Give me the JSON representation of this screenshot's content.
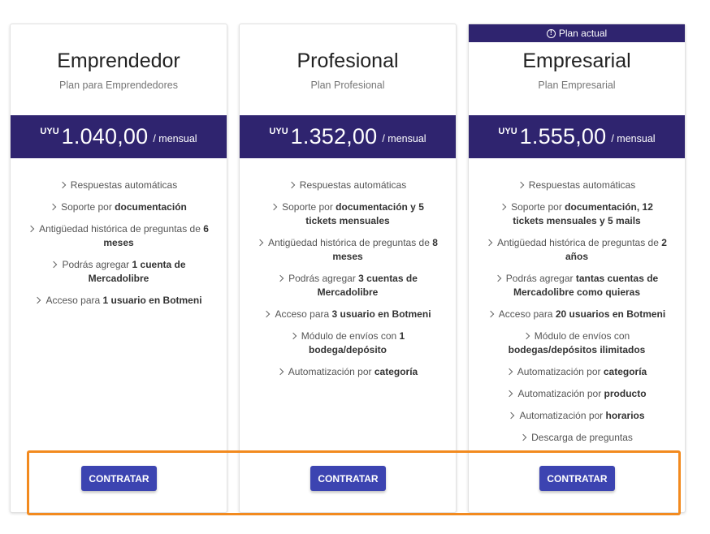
{
  "plans": [
    {
      "badge": "",
      "name": "Emprendedor",
      "subtitle": "Plan para Emprendedores",
      "currency": "UYU",
      "amount": "1.040,00",
      "period": "/ mensual",
      "features": [
        [
          [
            "Respuestas automáticas",
            false
          ]
        ],
        [
          [
            "Soporte por ",
            false
          ],
          [
            "documentación",
            true
          ]
        ],
        [
          [
            "Antigüedad histórica de preguntas de ",
            false
          ],
          [
            "6 meses",
            true
          ]
        ],
        [
          [
            "Podrás agregar ",
            false
          ],
          [
            "1 cuenta de Mercadolibre",
            true
          ]
        ],
        [
          [
            "Acceso para ",
            false
          ],
          [
            "1 usuario en Botmeni",
            true
          ]
        ]
      ],
      "button": "CONTRATAR"
    },
    {
      "badge": "",
      "name": "Profesional",
      "subtitle": "Plan Profesional",
      "currency": "UYU",
      "amount": "1.352,00",
      "period": "/ mensual",
      "features": [
        [
          [
            "Respuestas automáticas",
            false
          ]
        ],
        [
          [
            "Soporte por ",
            false
          ],
          [
            "documentación y 5 tickets mensuales",
            true
          ]
        ],
        [
          [
            "Antigüedad histórica de preguntas de ",
            false
          ],
          [
            "8 meses",
            true
          ]
        ],
        [
          [
            "Podrás agregar ",
            false
          ],
          [
            "3 cuentas de Mercadolibre",
            true
          ]
        ],
        [
          [
            "Acceso para ",
            false
          ],
          [
            "3 usuario en Botmeni",
            true
          ]
        ],
        [
          [
            "Módulo de envíos con ",
            false
          ],
          [
            "1 bodega/depósito",
            true
          ]
        ],
        [
          [
            "Automatización por ",
            false
          ],
          [
            "categoría",
            true
          ]
        ]
      ],
      "button": "CONTRATAR"
    },
    {
      "badge": "Plan actual",
      "name": "Empresarial",
      "subtitle": "Plan Empresarial",
      "currency": "UYU",
      "amount": "1.555,00",
      "period": "/ mensual",
      "features": [
        [
          [
            "Respuestas automáticas",
            false
          ]
        ],
        [
          [
            "Soporte por ",
            false
          ],
          [
            "documentación, 12 tickets mensuales y 5 mails",
            true
          ]
        ],
        [
          [
            "Antigüedad histórica de preguntas de ",
            false
          ],
          [
            "2 años",
            true
          ]
        ],
        [
          [
            "Podrás agregar ",
            false
          ],
          [
            "tantas cuentas de Mercadolibre como quieras",
            true
          ]
        ],
        [
          [
            "Acceso para ",
            false
          ],
          [
            "20 usuarios en Botmeni",
            true
          ]
        ],
        [
          [
            "Módulo de envíos con ",
            false
          ],
          [
            "bodegas/depósitos ilimitados",
            true
          ]
        ],
        [
          [
            "Automatización por ",
            false
          ],
          [
            "categoría",
            true
          ]
        ],
        [
          [
            "Automatización por ",
            false
          ],
          [
            "producto",
            true
          ]
        ],
        [
          [
            "Automatización por ",
            false
          ],
          [
            "horarios",
            true
          ]
        ],
        [
          [
            "Descarga de preguntas",
            false
          ]
        ]
      ],
      "button": "CONTRATAR"
    }
  ],
  "colors": {
    "brand_dark": "#2f246f",
    "button": "#3c44b1",
    "highlight": "#f28a1f"
  }
}
